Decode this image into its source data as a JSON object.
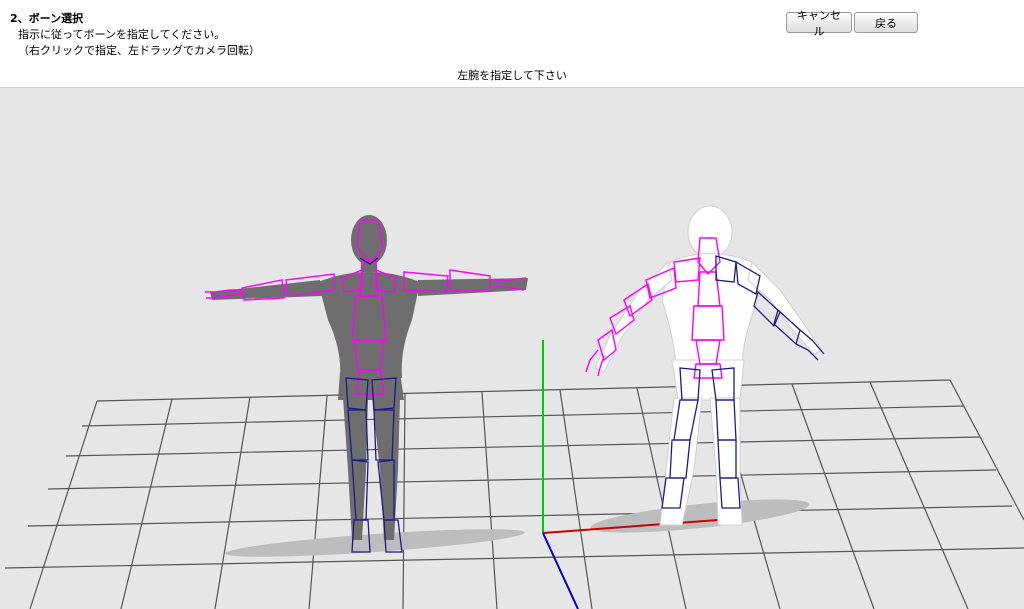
{
  "header": {
    "step_title": "2、ボーン選択",
    "instruction_line1": "指示に従ってボーンを指定してください。",
    "instruction_line2": "（右クリックで指定、左ドラッグでカメラ回転）",
    "prompt": "左腕を指定して下さい"
  },
  "buttons": {
    "cancel_label": "キャンセル",
    "back_label": "戻る"
  },
  "colors": {
    "background": "#e6e6e6",
    "grid": "#555555",
    "axis_y": "#00cc00",
    "axis_x": "#cc0000",
    "axis_z": "#0000cc",
    "bone_highlight": "#ff00ff",
    "bone_normal": "#1a1a8c",
    "model_gray": "#6e6e6e"
  }
}
